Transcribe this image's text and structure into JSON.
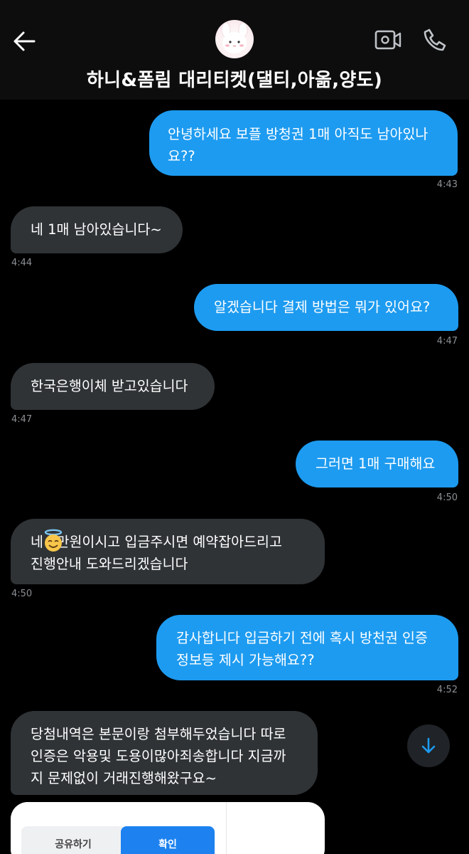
{
  "header": {
    "title": "하니&폼림 대리티켓(댈티,아옮,양도)",
    "back_icon": "arrow-left-icon",
    "video_icon": "video-call-icon",
    "phone_icon": "phone-icon"
  },
  "messages": [
    {
      "side": "sent",
      "text": "안녕하세요 보플 방청권 1매 아직도 남아있나\n요??",
      "time": "4:43"
    },
    {
      "side": "recv",
      "text": "네 1매 남아있습니다~",
      "time": "4:44"
    },
    {
      "side": "sent",
      "text": "알겠습니다 결제 방법은 뭐가 있어요?",
      "time": "4:47"
    },
    {
      "side": "recv",
      "text": "한국은행이체 받고있습니다",
      "time": "4:47"
    },
    {
      "side": "sent",
      "text": "그러면 1매 구매해요",
      "time": "4:50"
    },
    {
      "side": "recv",
      "text": "네   만원이시고 입금주시면 예약잡아드리고\n진행안내 도와드리겠습니다",
      "time": "4:50"
    },
    {
      "side": "sent",
      "text": "감사합니다 입금하기 전에 혹시 방천권 인증\n정보등 제시 가능해요??",
      "time": "4:52"
    },
    {
      "side": "recv",
      "text": "당첨내역은 본문이랑 첨부해두었습니다 따로\n인증은 악용및 도용이많아죄송합니다 지금까\n지 문제없이 거래진행해왔구요~",
      "time": ""
    }
  ],
  "attachment": {
    "share_label": "공유하기",
    "confirm_label": "확인"
  },
  "colors": {
    "sent_bubble": "#1d9bf0",
    "recv_bubble": "#2f3336",
    "background": "#000000"
  }
}
